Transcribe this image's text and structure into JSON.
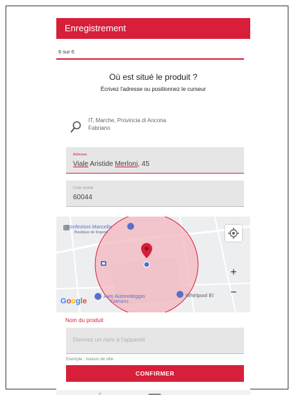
{
  "header": {
    "title": "Enregistrement"
  },
  "progress": {
    "label": "6 sur 6",
    "fraction": 1.0
  },
  "location": {
    "question": "Où est situé le produit ?",
    "instruction": "Écrivez l'adresse ou positionnez le curseur",
    "search_line1": "IT, Marche, Provincia di Ancona",
    "search_line2": "Fabriano"
  },
  "address_field": {
    "label": "Adresse",
    "value_part1": "Viale",
    "value_part2": " Aristide ",
    "value_part3": "Merloni",
    "value_part4": ", 45"
  },
  "postal_field": {
    "label": "Code postal",
    "value": "60044"
  },
  "map": {
    "poi1_name": "Confezioni Marcella",
    "poi1_sub": "Boutique de lingerie",
    "poi2_name": "Avis Autonoleggio",
    "poi2_sub": "Fabriano",
    "poi3_name": "Whirlpool El",
    "zoom_in": "+",
    "zoom_out": "−",
    "attribution": "Google"
  },
  "product": {
    "label": "Nom du produit",
    "placeholder": "Donnez un nom à l'appareil",
    "example": "Exemple : maison de ville"
  },
  "confirm_label": "CONFIRMER",
  "navigation": {
    "back": "‹"
  },
  "colors": {
    "accent": "#d71f3a",
    "map_circle": "#f3b7bf",
    "poi": "#5b6fc9"
  }
}
